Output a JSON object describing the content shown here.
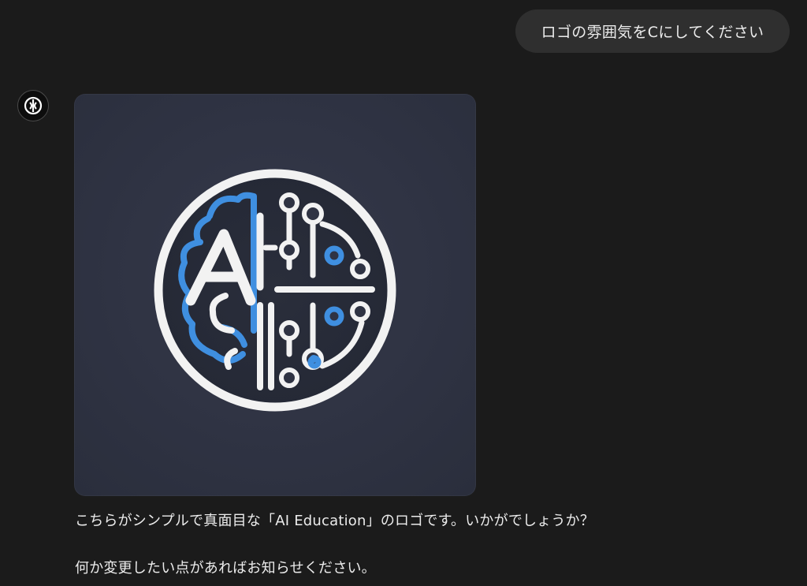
{
  "conversation": {
    "user_message": "ロゴの雰囲気をCにしてください",
    "assistant": {
      "avatar_icon": "openai-logo-icon",
      "image": {
        "logo_letters": "AI",
        "colors": {
          "background": "#2f3343",
          "ring": "#f2f2f2",
          "accent": "#3f8fe0"
        }
      },
      "reply_lines": [
        "こちらがシンプルで真面目な「AI Education」のロゴです。いかがでしょうか？",
        "何か変更したい点があればお知らせください。"
      ]
    }
  }
}
